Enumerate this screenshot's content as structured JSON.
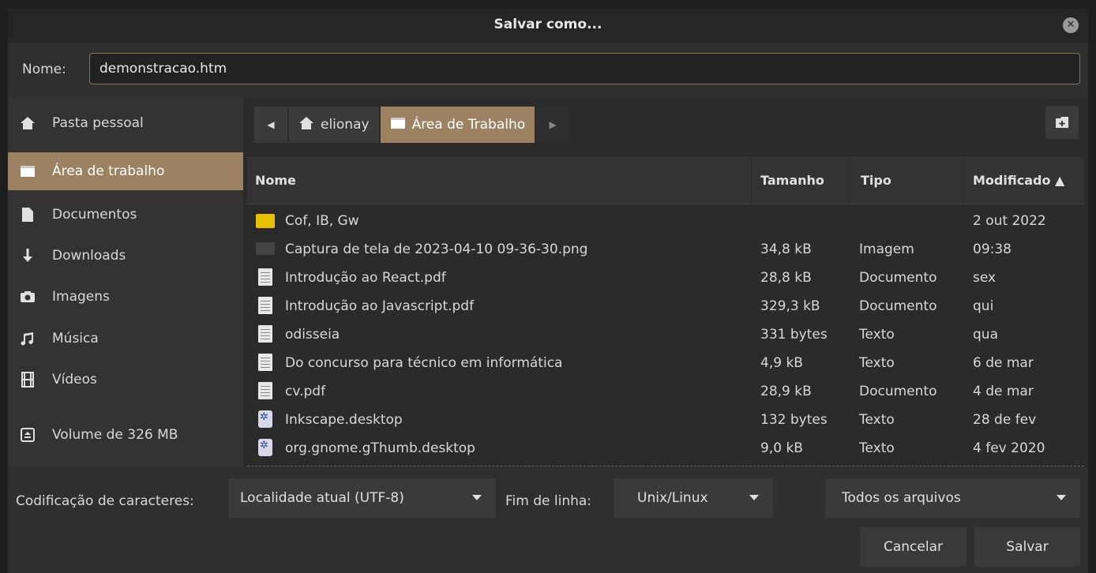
{
  "window": {
    "title": "Salvar como..."
  },
  "name_row": {
    "label": "Nome:",
    "value": "demonstracao.htm"
  },
  "sidebar": {
    "items": [
      {
        "label": "Pasta pessoal",
        "icon": "home-icon",
        "active": false
      },
      {
        "label": "Área de trabalho",
        "icon": "desktop-icon",
        "active": true
      },
      {
        "label": "Documentos",
        "icon": "document-icon",
        "active": false
      },
      {
        "label": "Downloads",
        "icon": "download-icon",
        "active": false
      },
      {
        "label": "Imagens",
        "icon": "camera-icon",
        "active": false
      },
      {
        "label": "Música",
        "icon": "music-icon",
        "active": false
      },
      {
        "label": "Vídeos",
        "icon": "film-icon",
        "active": false
      },
      {
        "label": "Volume de 326 MB",
        "icon": "drive-icon",
        "active": false
      }
    ]
  },
  "pathbar": {
    "segments": [
      {
        "label": "elionay",
        "icon": "home-icon"
      },
      {
        "label": "Área de Trabalho",
        "icon": "desktop-icon"
      }
    ]
  },
  "table": {
    "headers": {
      "name": "Nome",
      "size": "Tamanho",
      "type": "Tipo",
      "modified": "Modificado ▲"
    },
    "rows": [
      {
        "icon": "folder",
        "name": "Cof, IB, Gw",
        "size": "",
        "type": "",
        "modified": "2 out 2022"
      },
      {
        "icon": "image",
        "name": "Captura de tela de 2023-04-10 09-36-30.png",
        "size": "34,8 kB",
        "type": "Imagem",
        "modified": "09:38"
      },
      {
        "icon": "doc",
        "name": "Introdução ao React.pdf",
        "size": "28,8 kB",
        "type": "Documento",
        "modified": "sex"
      },
      {
        "icon": "doc",
        "name": "Introdução ao Javascript.pdf",
        "size": "329,3 kB",
        "type": "Documento",
        "modified": "qui"
      },
      {
        "icon": "doc",
        "name": "odisseia",
        "size": "331 bytes",
        "type": "Texto",
        "modified": "qua"
      },
      {
        "icon": "doc",
        "name": "Do concurso para técnico em informática",
        "size": "4,9 kB",
        "type": "Texto",
        "modified": "6 de mar"
      },
      {
        "icon": "doc",
        "name": "cv.pdf",
        "size": "28,9 kB",
        "type": "Documento",
        "modified": "4 de mar"
      },
      {
        "icon": "gear",
        "name": "Inkscape.desktop",
        "size": "132 bytes",
        "type": "Texto",
        "modified": "28 de fev"
      },
      {
        "icon": "gear",
        "name": "org.gnome.gThumb.desktop",
        "size": "9,0 kB",
        "type": "Texto",
        "modified": "4 fev 2020"
      }
    ]
  },
  "bottom": {
    "encoding_label": "Codificação de caracteres:",
    "encoding_value": "Localidade atual (UTF-8)",
    "eol_label": "Fim de linha:",
    "eol_value": "Unix/Linux",
    "filter_value": "Todos os arquivos",
    "cancel_label": "Cancelar",
    "save_label": "Salvar"
  },
  "colors": {
    "accent": "#9c8262",
    "background": "#2b2b2b",
    "folder": "#e6c200"
  }
}
